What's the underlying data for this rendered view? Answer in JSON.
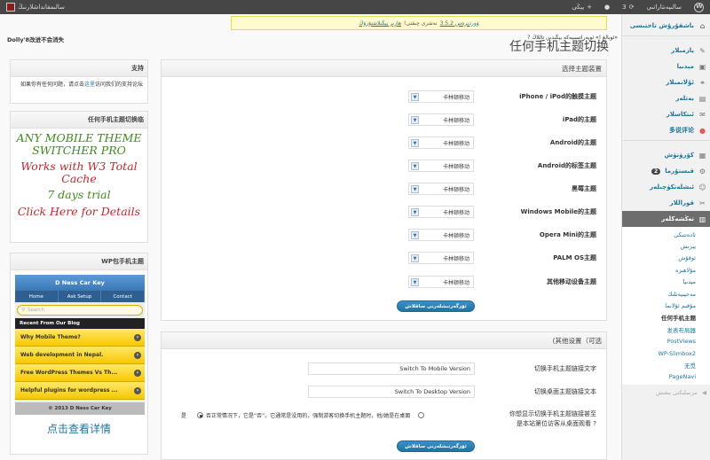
{
  "adminbar": {
    "user_name": "سالىم‍قانداشلارنىڭ",
    "site_name": "سالىپەنتاراتىي",
    "updates_count": "3",
    "new_label": "يېڭى"
  },
  "nag": {
    "version_link": "ۋوردپرەس 3.5.2",
    "text": "نەشرى چىقتى!",
    "action_link": "ھازىر يېڭىلاشتۇرۇڭ"
  },
  "notice_left": "Dolly'8改进不会消失",
  "notice_right": "«ئوبالغ !» ئوپەراتسىيەكە يېڭىدىن تاللاڭ ?",
  "page_title": "任何手机主题切换",
  "sidebar": {
    "items": [
      {
        "label": "باشقۇرۇش تاختىسى",
        "icon": "dashboard-icon",
        "glyph": "⌂"
      },
      {
        "label": "يازمىلار",
        "icon": "pin-icon",
        "glyph": "✎"
      },
      {
        "label": "مېدىيا",
        "icon": "media-icon",
        "glyph": "▣"
      },
      {
        "label": "ئۇلانمىلار",
        "icon": "link-icon",
        "glyph": "⚭"
      },
      {
        "label": "بەتلەر",
        "icon": "page-icon",
        "glyph": "▤"
      },
      {
        "label": "ئىنكاسلار",
        "icon": "comments-icon",
        "glyph": "✉"
      },
      {
        "label": "多说评论",
        "icon": "duoshuo-icon",
        "glyph": "●"
      }
    ],
    "items2": [
      {
        "label": "كۆرۈنۈش",
        "icon": "appearance-icon",
        "glyph": "▦"
      },
      {
        "label": "قىستۇرما",
        "icon": "plugins-icon",
        "glyph": "⚙",
        "badge": "2"
      },
      {
        "label": "ئىشلەتكۈچىلەر",
        "icon": "users-icon",
        "glyph": "☺"
      },
      {
        "label": "قوراللار",
        "icon": "tools-icon",
        "glyph": "✂"
      }
    ],
    "settings": {
      "label": "تەڭشەكلەر",
      "icon": "settings-icon",
      "glyph": "▥"
    },
    "submenu": [
      "ئادەتتىكى",
      "يېزىش",
      "ئوقۇش",
      "مۇلاھىزە",
      "مېدىيا",
      "مەخپىيەتلىك",
      "مۇقىم ئۇلانما",
      "任何手机主题",
      "发表布局器",
      "PostViews",
      "WP-Slimbox2",
      "无觅",
      "PageNavi"
    ],
    "collapse": "تىزىملىكنى يىغىش"
  },
  "support_widget": {
    "title": "支持",
    "text1": "如果你有任何问题，请点击",
    "link": "这里",
    "text2": "访问我们的支持论坛"
  },
  "promo_widget": {
    "title": "任何手机主题切换临",
    "line1": "ANY MOBILE THEME SWITCHER PRO",
    "line2": "Works with W3 Total Cache",
    "line3": "7 days trial",
    "line4": "Click Here for Details"
  },
  "mobile_widget": {
    "title": "WP包手机主题",
    "site": "D Ness Car Key",
    "nav": [
      "Home",
      "Ask Setup",
      "Contact"
    ],
    "search_placeholder": "Search",
    "blog_header": "Recent From Our Blog",
    "posts": [
      "Why Mobile Theme?",
      "Web development in Nepal.",
      "Free WordPress Themes Vs Th...",
      "Helpful plugins for wordpress ..."
    ],
    "footer": "© 2013 D Ness Car Key",
    "more_link": "点击查看详情"
  },
  "select_panel": {
    "title": "选择主题装置",
    "rows": [
      {
        "label": "iPhone / iPod的触摸主题",
        "value": "卡林顿移动"
      },
      {
        "label": "iPad的主题",
        "value": "卡林顿移动"
      },
      {
        "label": "Android的主题",
        "value": "卡林顿移动"
      },
      {
        "label": "Android的标签主题",
        "value": "卡林顿移动"
      },
      {
        "label": "黑莓主题",
        "value": "卡林顿移动"
      },
      {
        "label": "Windows Mobile的主题",
        "value": "卡林顿移动"
      },
      {
        "label": "Opera Mini的主题",
        "value": "卡林顿移动"
      },
      {
        "label": "PALM OS主题",
        "value": "卡林顿移动"
      },
      {
        "label": "其他移动设备主题",
        "value": "卡林顿移动"
      }
    ],
    "save_label": "ئۆزگەرتىشلەرنى ساقلاش"
  },
  "other_panel": {
    "title": "(其他设置（可选",
    "mobile_link_label": "切换手机主题链接文字",
    "mobile_link_value": "Switch To Mobile Version",
    "desktop_link_label": "切换桌面主题链接文本",
    "desktop_link_value": "Switch To Desktop Version",
    "question_line1": "你想显示切换手机主题链接甚至",
    "question_line2": "是本站第位访客从桌面观看 ?",
    "radio_yes": "是",
    "radio_no_text": "否正常情况下，它是“否”。它通常是没用的，强制游客切换手机主题时，他/她是在桌面",
    "save_label": "ئۆزگەرتىشلەرنى ساقلاش"
  }
}
